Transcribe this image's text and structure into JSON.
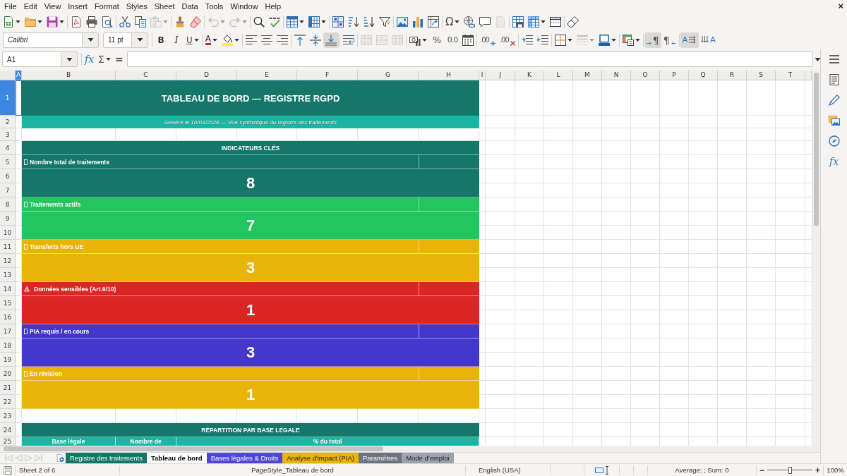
{
  "menu": [
    "File",
    "Edit",
    "View",
    "Insert",
    "Format",
    "Styles",
    "Sheet",
    "Data",
    "Tools",
    "Window",
    "Help"
  ],
  "close": "×",
  "toolbar_standard": [
    {
      "kind": "new",
      "dropdown": true
    },
    {
      "kind": "open",
      "dropdown": true
    },
    {
      "kind": "save",
      "dropdown": true
    },
    {
      "kind": "separator"
    },
    {
      "kind": "export_pdf"
    },
    {
      "kind": "print"
    },
    {
      "kind": "preview"
    },
    {
      "kind": "separator"
    },
    {
      "kind": "cut"
    },
    {
      "kind": "copy"
    },
    {
      "kind": "paste",
      "dropdown": true,
      "disabled": true
    },
    {
      "kind": "separator"
    },
    {
      "kind": "clone"
    },
    {
      "kind": "clear_format"
    },
    {
      "kind": "separator"
    },
    {
      "kind": "undo",
      "dropdown": true,
      "disabled": true
    },
    {
      "kind": "redo",
      "dropdown": true,
      "disabled": true
    },
    {
      "kind": "separator"
    },
    {
      "kind": "find"
    },
    {
      "kind": "spelling"
    },
    {
      "kind": "separator"
    },
    {
      "kind": "rows",
      "dropdown": true
    },
    {
      "kind": "columns",
      "dropdown": true
    },
    {
      "kind": "separator"
    },
    {
      "kind": "sort"
    },
    {
      "kind": "sort_asc"
    },
    {
      "kind": "sort_desc"
    },
    {
      "kind": "filter"
    },
    {
      "kind": "separator"
    },
    {
      "kind": "image"
    },
    {
      "kind": "chart"
    },
    {
      "kind": "pivot"
    },
    {
      "kind": "separator"
    },
    {
      "kind": "special",
      "label": "Ω",
      "dropdown": true
    },
    {
      "kind": "link"
    },
    {
      "kind": "comment"
    },
    {
      "kind": "header_footer",
      "disabled": true
    },
    {
      "kind": "separator"
    },
    {
      "kind": "print_area"
    },
    {
      "kind": "freeze",
      "dropdown": true
    },
    {
      "kind": "split"
    },
    {
      "kind": "separator"
    },
    {
      "kind": "shapes"
    }
  ],
  "font_name": "Calibri",
  "font_size": "11 pt",
  "toolbar_formatting": [
    {
      "kind": "bold",
      "label": "B"
    },
    {
      "kind": "italic",
      "label": "I"
    },
    {
      "kind": "underline",
      "label": "U",
      "dropdown": true
    },
    {
      "kind": "separator"
    },
    {
      "kind": "font_color",
      "label": "A",
      "dropdown": true
    },
    {
      "kind": "highlight",
      "dropdown": true
    },
    {
      "kind": "separator"
    },
    {
      "kind": "align_left"
    },
    {
      "kind": "align_center"
    },
    {
      "kind": "align_right"
    },
    {
      "kind": "separator"
    },
    {
      "kind": "align_top"
    },
    {
      "kind": "align_middle"
    },
    {
      "kind": "align_bottom",
      "pressed": true
    },
    {
      "kind": "separator"
    },
    {
      "kind": "wrap"
    },
    {
      "kind": "separator"
    },
    {
      "kind": "merge_center",
      "disabled": true
    },
    {
      "kind": "merge",
      "disabled": true
    },
    {
      "kind": "unmerge",
      "disabled": true
    },
    {
      "kind": "separator"
    },
    {
      "kind": "currency",
      "dropdown": true
    },
    {
      "kind": "percent",
      "label": "%"
    },
    {
      "kind": "number",
      "label": "0.0"
    },
    {
      "kind": "date"
    },
    {
      "kind": "separator"
    },
    {
      "kind": "add_decimal",
      "label": ".00"
    },
    {
      "kind": "delete_decimal",
      "label": ".00"
    },
    {
      "kind": "separator"
    },
    {
      "kind": "indent"
    },
    {
      "kind": "outdent"
    },
    {
      "kind": "separator"
    },
    {
      "kind": "borders",
      "dropdown": true
    },
    {
      "kind": "border_style",
      "dropdown": true,
      "disabled": true
    },
    {
      "kind": "border_color",
      "dropdown": true
    },
    {
      "kind": "separator"
    },
    {
      "kind": "conditional",
      "dropdown": true
    },
    {
      "kind": "separator"
    },
    {
      "kind": "para_ltr",
      "label": "¶",
      "pressed": true
    },
    {
      "kind": "para_rtl",
      "label": "¶"
    },
    {
      "kind": "separator"
    },
    {
      "kind": "text_ltr",
      "label": "A",
      "pressed": true
    },
    {
      "kind": "text_ttb",
      "label": "A"
    }
  ],
  "name_box": "A1",
  "formula_buttons": [
    {
      "kind": "function_wizard",
      "label": "fx"
    },
    {
      "kind": "sum",
      "label": "Σ",
      "dropdown": true
    },
    {
      "kind": "formula",
      "label": "="
    }
  ],
  "columns": [
    {
      "label": "A",
      "selected": true
    },
    {
      "label": "B",
      "selected": false
    },
    {
      "label": "C",
      "selected": false
    },
    {
      "label": "D",
      "selected": false
    },
    {
      "label": "E",
      "selected": false
    },
    {
      "label": "F",
      "selected": false
    },
    {
      "label": "G",
      "selected": false
    },
    {
      "label": "H",
      "selected": false
    },
    {
      "label": "I",
      "selected": false
    },
    {
      "label": "J",
      "selected": false
    },
    {
      "label": "K",
      "selected": false
    },
    {
      "label": "L",
      "selected": false
    },
    {
      "label": "M",
      "selected": false
    },
    {
      "label": "N",
      "selected": false
    },
    {
      "label": "O",
      "selected": false
    },
    {
      "label": "P",
      "selected": false
    },
    {
      "label": "Q",
      "selected": false
    },
    {
      "label": "R",
      "selected": false
    },
    {
      "label": "S",
      "selected": false
    },
    {
      "label": "T",
      "selected": false
    }
  ],
  "rows": [
    {
      "label": "1",
      "selected": true
    },
    {
      "label": "2",
      "selected": false
    },
    {
      "label": "3",
      "selected": false
    },
    {
      "label": "4",
      "selected": false
    },
    {
      "label": "5",
      "selected": false
    },
    {
      "label": "6",
      "selected": false
    },
    {
      "label": "7",
      "selected": false
    },
    {
      "label": "8",
      "selected": false
    },
    {
      "label": "9",
      "selected": false
    },
    {
      "label": "10",
      "selected": false
    },
    {
      "label": "11",
      "selected": false
    },
    {
      "label": "12",
      "selected": false
    },
    {
      "label": "13",
      "selected": false
    },
    {
      "label": "14",
      "selected": false
    },
    {
      "label": "15",
      "selected": false
    },
    {
      "label": "16",
      "selected": false
    },
    {
      "label": "17",
      "selected": false
    },
    {
      "label": "18",
      "selected": false
    },
    {
      "label": "19",
      "selected": false
    },
    {
      "label": "20",
      "selected": false
    },
    {
      "label": "21",
      "selected": false
    },
    {
      "label": "22",
      "selected": false
    },
    {
      "label": "23",
      "selected": false
    },
    {
      "label": "24",
      "selected": false
    },
    {
      "label": "25",
      "selected": false
    }
  ],
  "sheet": {
    "title": "TABLEAU DE BORD — REGISTRE RGPD",
    "subtitle": "Généré le 16/03/2026 — Vue synthétique du registre des traitements",
    "indicators_header": "INDICATEURS CLÉS",
    "indicators": [
      {
        "missing_glyph": true,
        "label": "Nombre total de traitements",
        "value": "8",
        "color": "#14776a"
      },
      {
        "missing_glyph": true,
        "label": "Traitements actifs",
        "value": "7",
        "color": "#22c55e"
      },
      {
        "missing_glyph": true,
        "label": "Transferts hors UE",
        "value": "3",
        "color": "#eab308"
      },
      {
        "symbol": "⚠",
        "label": "Données sensibles (Art.9/10)",
        "value": "1",
        "color": "#dc2626"
      },
      {
        "missing_glyph": true,
        "label": "PIA requis / en cours",
        "value": "3",
        "color": "#4338ca"
      },
      {
        "missing_glyph": true,
        "label": "En révision",
        "value": "1",
        "color": "#eab308"
      }
    ],
    "breakdown_header": "RÉPARTITION PAR BASE LÉGALE",
    "breakdown_columns": [
      "Base légale",
      "Nombre de",
      "% du total"
    ]
  },
  "sheet_navigation": [
    {
      "kind": "first",
      "disabled": true
    },
    {
      "kind": "previous",
      "disabled": true
    },
    {
      "kind": "next",
      "disabled": true
    },
    {
      "kind": "last",
      "disabled": true
    }
  ],
  "sheet_tabs": [
    {
      "label": "Registre des traitements",
      "color": "#14776a",
      "selected": false
    },
    {
      "label": "Tableau de bord",
      "selected": true
    },
    {
      "label": "Bases légales & Droits",
      "color": "#4f46d8",
      "selected": false
    },
    {
      "label": "Analyse d'impact (PIA)",
      "color": "#eab308",
      "selected": false
    },
    {
      "label": "Paramètres",
      "color": "#6b7280",
      "selected": false
    },
    {
      "label": "Mode d'emploi",
      "color": "#9ca3af",
      "selected": false
    }
  ],
  "status_bar": {
    "sheet": "Sheet 2 of 6",
    "page_style": "PageStyle_Tableau de bord",
    "language": "English (USA)",
    "summary": "Average: ; Sum: 0",
    "zoom_out": "−",
    "zoom": {
      "level": 0.5
    },
    "zoom_in": "+",
    "zoom_percent": "100%"
  },
  "sidebar": [
    {
      "kind": "menu"
    },
    {
      "kind": "properties"
    },
    {
      "kind": "styles"
    },
    {
      "kind": "gallery"
    },
    {
      "kind": "navigator"
    },
    {
      "kind": "functions",
      "label": "fx"
    }
  ]
}
